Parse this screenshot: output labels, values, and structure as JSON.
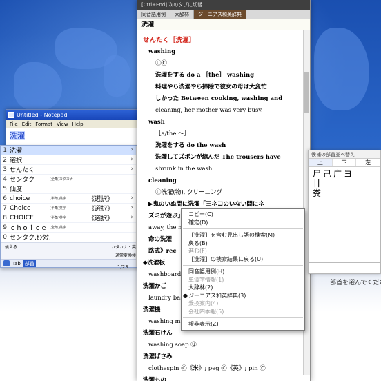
{
  "notepad": {
    "title": "Untitled - Notepad",
    "menu": [
      "File",
      "Edit",
      "Format",
      "View",
      "Help"
    ],
    "composing_text": "洗濯"
  },
  "ime_candidates": {
    "items": [
      {
        "num": "1",
        "word": "洗濯",
        "note": "",
        "sub": "",
        "arrow": "›",
        "selected": true
      },
      {
        "num": "2",
        "word": "選択",
        "note": "",
        "sub": "",
        "arrow": "›",
        "selected": false
      },
      {
        "num": "3",
        "word": "せんたく",
        "note": "",
        "sub": "",
        "arrow": "›",
        "selected": false
      },
      {
        "num": "4",
        "word": "センタク",
        "note": "[全角]カタカナ",
        "sub": "",
        "arrow": "",
        "selected": false
      },
      {
        "num": "5",
        "word": "仙度",
        "note": "",
        "sub": "",
        "arrow": "",
        "selected": false
      },
      {
        "num": "6",
        "word": "choice",
        "note": "[半角]英字",
        "sub": "《選択》",
        "arrow": "›",
        "selected": false
      },
      {
        "num": "7",
        "word": "Choice",
        "note": "[半角]英字",
        "sub": "《選択》",
        "arrow": "›",
        "selected": false
      },
      {
        "num": "8",
        "word": "CHOICE",
        "note": "[半角]英字",
        "sub": "《選択》",
        "arrow": "›",
        "selected": false
      },
      {
        "num": "9",
        "word": "ｃｈｏｉｃｅ",
        "note": "[全角]英字",
        "sub": "",
        "arrow": "",
        "selected": false
      },
      {
        "num": "0",
        "word": "センタク,ｾﾝﾀｸ…",
        "note": "",
        "sub": "",
        "arrow": "",
        "selected": false
      }
    ],
    "footer_left": "候える",
    "footer_right": "カタカナ・英字",
    "footer2_right": "通常変換候補",
    "toolbar_tab": "Tab",
    "toolbar_hint": "部首",
    "page_indicator": "1/23"
  },
  "dictionary": {
    "top_hint": "[Ctrl+End] 次のタブに切替",
    "tabs": [
      "同音語用例",
      "大辞林",
      "ジーニアス和英辞典"
    ],
    "active_tab_index": 2,
    "heading": "洗濯",
    "headword": "せんたく［洗濯］",
    "entries": [
      {
        "cls": "ind1 pos",
        "text": "washing"
      },
      {
        "cls": "ind2",
        "text": "ⓊⒸ"
      },
      {
        "cls": "ind2 bold",
        "text": "洗濯をする do a ［the］ washing"
      },
      {
        "cls": "ind2 bold",
        "text": "料理やら洗濯やら掃除で彼女の母は大変忙"
      },
      {
        "cls": "ind2 bold",
        "text": "しかった Between cooking, washing and"
      },
      {
        "cls": "ind2",
        "text": "cleaning, her mother was very busy."
      },
      {
        "cls": "ind1 pos",
        "text": "wash"
      },
      {
        "cls": "ind2",
        "text": "［a/the 〜］"
      },
      {
        "cls": "ind2 bold",
        "text": "洗濯をする do the wash"
      },
      {
        "cls": "ind2 bold",
        "text": "洗濯してズボンが縮んだ The trousers have"
      },
      {
        "cls": "ind2",
        "text": "shrunk in the wash."
      },
      {
        "cls": "ind1 pos",
        "text": "cleaning"
      },
      {
        "cls": "ind2",
        "text": "Ⓤ洗濯(物), クリーニング"
      },
      {
        "cls": "ind1 bold",
        "text": "▶鬼のいぬ間に洗濯「三ネコのいない間にネ"
      },
      {
        "cls": "ind1 bold",
        "text": "ズミが遊ぶ」"
      },
      {
        "cls": "ind1",
        "text": "away, the mice..."
      },
      {
        "cls": "ind1 bold",
        "text": "命の洗濯"
      },
      {
        "cls": "ind1 bold",
        "text": "路式》rec"
      },
      {
        "cls": "pos",
        "text": "◆洗濯板"
      },
      {
        "cls": "ind1",
        "text": "washboard"
      },
      {
        "cls": "pos",
        "text": "洗濯かご"
      },
      {
        "cls": "ind1",
        "text": "laundry bas"
      },
      {
        "cls": "pos",
        "text": "洗濯機"
      },
      {
        "cls": "ind1",
        "text": "washing m"
      },
      {
        "cls": "pos",
        "text": "洗濯石けん"
      },
      {
        "cls": "ind1",
        "text": "washing soap Ⓤ"
      },
      {
        "cls": "pos",
        "text": "洗濯ばさみ"
      },
      {
        "cls": "ind1",
        "text": "clothespin Ⓒ《米》; peg Ⓒ《英》; pin Ⓒ"
      },
      {
        "cls": "pos",
        "text": "洗濯もの"
      }
    ]
  },
  "context_menu": {
    "items": [
      {
        "type": "item",
        "label": "コピー(C)",
        "disabled": false,
        "bullet": ""
      },
      {
        "type": "item",
        "label": "確定(D)",
        "disabled": false,
        "bullet": ""
      },
      {
        "type": "sep"
      },
      {
        "type": "item",
        "label": "【洗濯】を含む見出し語の検索(M)",
        "disabled": false,
        "bullet": ""
      },
      {
        "type": "item",
        "label": "戻る(B)",
        "disabled": false,
        "bullet": ""
      },
      {
        "type": "item",
        "label": "進む(F)",
        "disabled": true,
        "bullet": ""
      },
      {
        "type": "item",
        "label": "【洗濯】の検索結果に戻る(U)",
        "disabled": false,
        "bullet": ""
      },
      {
        "type": "sep"
      },
      {
        "type": "item",
        "label": "同音語用例(H)",
        "disabled": false,
        "bullet": ""
      },
      {
        "type": "item",
        "label": "単漢字情報(1)",
        "disabled": true,
        "bullet": ""
      },
      {
        "type": "item",
        "label": "大辞林(2)",
        "disabled": false,
        "bullet": ""
      },
      {
        "type": "item",
        "label": "ジーニアス和英辞典(3)",
        "disabled": false,
        "bullet": "●"
      },
      {
        "type": "item",
        "label": "乗換案内(4)",
        "disabled": true,
        "bullet": ""
      },
      {
        "type": "item",
        "label": "会社四季報(5)",
        "disabled": true,
        "bullet": ""
      },
      {
        "type": "sep"
      },
      {
        "type": "item",
        "label": "報非表示(Z)",
        "disabled": false,
        "bullet": ""
      }
    ]
  },
  "radical_panel": {
    "title": "候補の部首並べ替え",
    "tabs": [
      "上",
      "下",
      "左"
    ],
    "chars": "尸己广ヨ\n廿\n粪",
    "message": "部首を選んでください。"
  }
}
